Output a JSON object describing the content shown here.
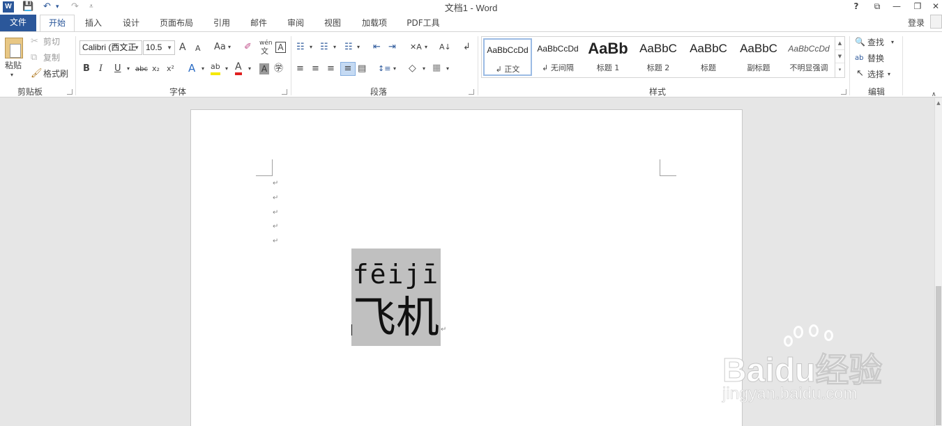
{
  "window": {
    "title": "文档1 - Word",
    "app_icon_letter": "W",
    "help": "?",
    "ribbon_display": "⧉",
    "minimize": "—",
    "restore": "❐",
    "close": "✕"
  },
  "qat": {
    "save": "💾",
    "undo": "↶",
    "undo_arrow": "▾",
    "redo": "↷",
    "customize": "⩡"
  },
  "tabs": {
    "file": "文件",
    "items": [
      "开始",
      "插入",
      "设计",
      "页面布局",
      "引用",
      "邮件",
      "审阅",
      "视图",
      "加载项",
      "PDF工具"
    ],
    "login": "登录"
  },
  "clipboard": {
    "paste": "粘贴",
    "paste_arrow": "▾",
    "cut": "剪切",
    "copy": "复制",
    "format_painter": "格式刷",
    "group": "剪贴板"
  },
  "font": {
    "name": "Calibri (西文正",
    "size": "10.5",
    "grow": "A",
    "shrink": "A",
    "change_case": "Aa",
    "clear_format": "✐",
    "phonetic_top": "wén",
    "phonetic_bottom": "文",
    "char_border": "A",
    "bold": "B",
    "italic": "I",
    "underline": "U",
    "strikethrough": "abc",
    "subscript": "x₂",
    "superscript": "x²",
    "text_effects": "A",
    "highlight": "ab",
    "font_color": "A",
    "char_shading": "A",
    "enclose": "㊫",
    "group": "字体"
  },
  "paragraph": {
    "bullets": "☷",
    "numbering": "☷",
    "multilevel": "☷",
    "decrease_indent": "⇤",
    "increase_indent": "⇥",
    "chinese_layout": "✕A",
    "sort": "A↓",
    "show_marks": "↲",
    "align_left": "≡",
    "center": "≡",
    "align_right": "≡",
    "justify": "≡",
    "distributed": "▤",
    "line_spacing": "↕≡",
    "shading": "◇",
    "borders": "▦",
    "group": "段落"
  },
  "styles": {
    "items": [
      {
        "sample": "AaBbCcDd",
        "name": "↲ 正文"
      },
      {
        "sample": "AaBbCcDd",
        "name": "↲ 无间隔"
      },
      {
        "sample": "AaBb",
        "name": "标题 1"
      },
      {
        "sample": "AaBbC",
        "name": "标题 2"
      },
      {
        "sample": "AaBbC",
        "name": "标题"
      },
      {
        "sample": "AaBbC",
        "name": "副标题"
      },
      {
        "sample": "AaBbCcDd",
        "name": "不明显强调"
      }
    ],
    "scroll_up": "▲",
    "scroll_down": "▼",
    "more": "▾",
    "group": "样式"
  },
  "editing": {
    "find": "查找",
    "find_icon": "🔍",
    "replace": "替换",
    "replace_icon": "ab",
    "select": "选择",
    "select_icon": "↖",
    "arrow": "▾",
    "group": "编辑"
  },
  "document": {
    "paragraph_mark": "↵",
    "pinyin": "fēijī",
    "hanzi": "飞机"
  },
  "watermark": {
    "brand": "Baidu经验",
    "url": "jingyan.baidu.com"
  }
}
